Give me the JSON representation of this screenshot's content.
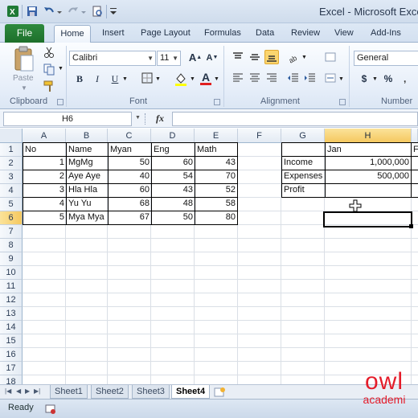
{
  "window": {
    "title": "Excel - Microsoft Exce"
  },
  "quick_access": [
    "save-icon",
    "undo-icon",
    "redo-icon",
    "print-preview-icon",
    "customize-icon"
  ],
  "ribbon_tabs": [
    {
      "label": "File"
    },
    {
      "label": "Home"
    },
    {
      "label": "Insert"
    },
    {
      "label": "Page Layout"
    },
    {
      "label": "Formulas"
    },
    {
      "label": "Data"
    },
    {
      "label": "Review"
    },
    {
      "label": "View"
    },
    {
      "label": "Add-Ins"
    }
  ],
  "ribbon": {
    "clipboard": {
      "label": "Clipboard",
      "paste": "Paste"
    },
    "font": {
      "label": "Font",
      "name": "Calibri",
      "size": "11"
    },
    "alignment": {
      "label": "Alignment"
    },
    "number": {
      "label": "Number",
      "format": "General",
      "currency": "$",
      "percent": "%"
    }
  },
  "formula_bar": {
    "name_box": "H6",
    "fx": "fx",
    "value": ""
  },
  "columns": [
    "A",
    "B",
    "C",
    "D",
    "E",
    "F",
    "G",
    "H"
  ],
  "selected_column": "H",
  "rows": [
    "1",
    "2",
    "3",
    "4",
    "5",
    "6",
    "7",
    "8",
    "9",
    "10",
    "11",
    "12",
    "13",
    "14",
    "15",
    "16",
    "17",
    "18"
  ],
  "selected_row": "6",
  "table1": {
    "headers": [
      "No",
      "Name",
      "Myan",
      "Eng",
      "Math"
    ],
    "rows": [
      [
        "1",
        "MgMg",
        "50",
        "60",
        "43"
      ],
      [
        "2",
        "Aye Aye",
        "40",
        "54",
        "70"
      ],
      [
        "3",
        "Hla Hla",
        "60",
        "43",
        "52"
      ],
      [
        "4",
        "Yu Yu",
        "68",
        "48",
        "58"
      ],
      [
        "5",
        "Mya Mya",
        "67",
        "50",
        "80"
      ]
    ]
  },
  "table2": {
    "header_h": "Jan",
    "header_i": "F",
    "labels": [
      "Income",
      "Expenses",
      "Profit"
    ],
    "values": [
      "1,000,000",
      "500,000",
      ""
    ]
  },
  "sheets": [
    {
      "label": "Sheet1",
      "active": false
    },
    {
      "label": "Sheet2",
      "active": false
    },
    {
      "label": "Sheet3",
      "active": false
    },
    {
      "label": "Sheet4",
      "active": true
    }
  ],
  "status": {
    "text": "Ready"
  },
  "logo": {
    "line1": "owl",
    "line2": "academi"
  }
}
